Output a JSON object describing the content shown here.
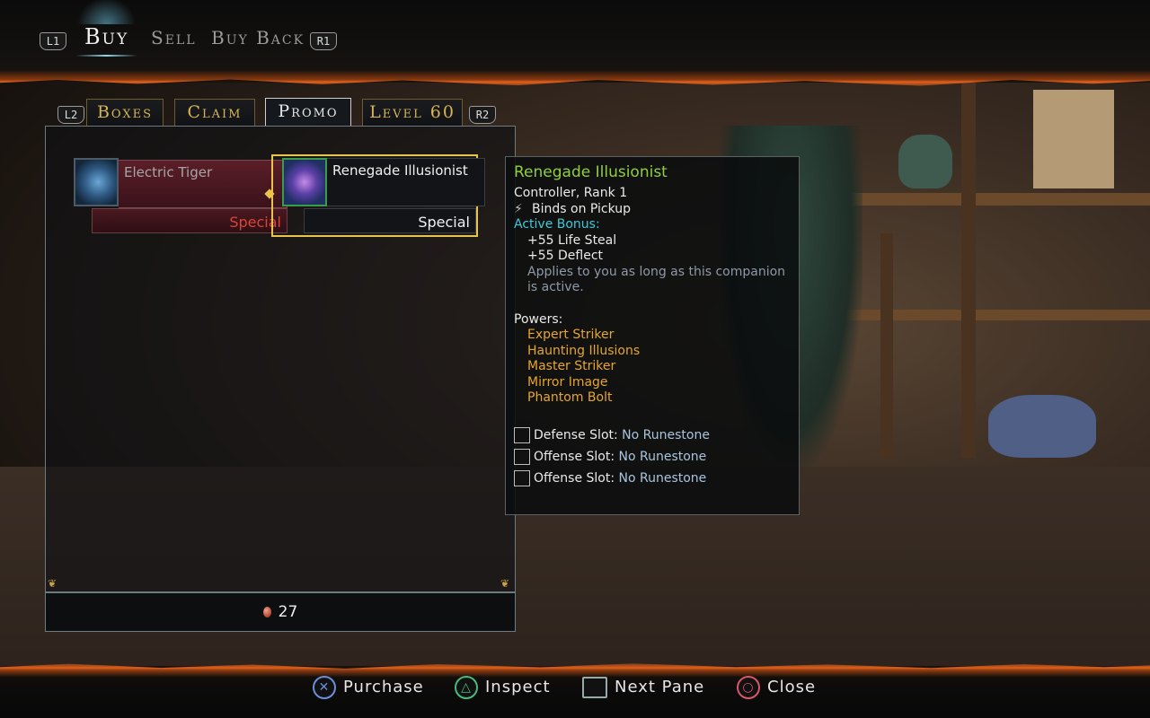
{
  "header": {
    "left_shoulder": "L1",
    "right_shoulder": "R1",
    "tabs": [
      {
        "label": "Buy",
        "active": true
      },
      {
        "label": "Sell",
        "active": false
      },
      {
        "label": "Buy Back",
        "active": false
      }
    ]
  },
  "categories": {
    "left_shoulder": "L2",
    "right_shoulder": "R2",
    "tabs": [
      {
        "label": "Boxes",
        "active": false
      },
      {
        "label": "Claim",
        "active": false
      },
      {
        "label": "Promo",
        "active": true
      },
      {
        "label": "Level 60",
        "active": false
      }
    ]
  },
  "items": [
    {
      "name": "Electric Tiger",
      "rarity": "Special",
      "icon": "tiger-icon"
    },
    {
      "name": "Renegade Illusionist",
      "rarity": "Special",
      "icon": "illusionist-icon",
      "selected": true
    }
  ],
  "currency": {
    "amount": "27",
    "icon": "coin-icon"
  },
  "tooltip": {
    "title": "Renegade Illusionist",
    "subtitle": "Controller, Rank 1",
    "binds": "Binds on Pickup",
    "active_bonus_label": "Active Bonus:",
    "bonuses": [
      "+55 Life Steal",
      "+55 Deflect"
    ],
    "bonus_desc": "Applies to you as long as this companion is active.",
    "powers_label": "Powers:",
    "powers": [
      "Expert Striker",
      "Haunting Illusions",
      "Master Striker",
      "Mirror Image",
      "Phantom Bolt"
    ],
    "slots": [
      {
        "label": "Defense Slot:",
        "value": "No Runestone"
      },
      {
        "label": "Offense Slot:",
        "value": "No Runestone"
      },
      {
        "label": "Offense Slot:",
        "value": "No Runestone"
      }
    ]
  },
  "prompts": [
    {
      "button": "✕",
      "label": "Purchase"
    },
    {
      "button": "△",
      "label": "Inspect"
    },
    {
      "button": "",
      "label": "Next Pane"
    },
    {
      "button": "○",
      "label": "Close"
    }
  ],
  "colors": {
    "accent_gold": "#e8c44a",
    "title_green": "#8fcf3c",
    "bonus_cyan": "#3fc8d8",
    "power_gold": "#e6a62c",
    "rarity_red": "#d8443a"
  }
}
